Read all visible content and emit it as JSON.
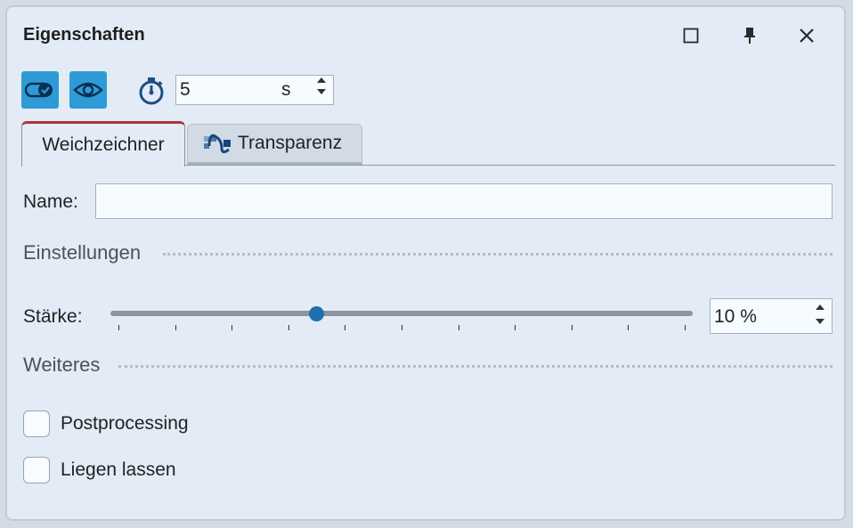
{
  "window": {
    "title": "Eigenschaften"
  },
  "toolbar": {
    "timer_value": "5",
    "timer_unit": "s"
  },
  "tabs": [
    {
      "label": "Weichzeichner",
      "active": true
    },
    {
      "label": "Transparenz",
      "active": false
    }
  ],
  "form": {
    "name_label": "Name:",
    "name_value": "",
    "section_settings": "Einstellungen",
    "strength_label": "Stärke:",
    "strength_value": "10 %",
    "section_more": "Weiteres",
    "checkboxes": [
      {
        "label": "Postprocessing",
        "checked": false
      },
      {
        "label": "Liegen lassen",
        "checked": false
      }
    ]
  },
  "colors": {
    "accent": "#2e9bd6",
    "tab_active_border": "#b03238",
    "slider_thumb": "#2070ad"
  }
}
